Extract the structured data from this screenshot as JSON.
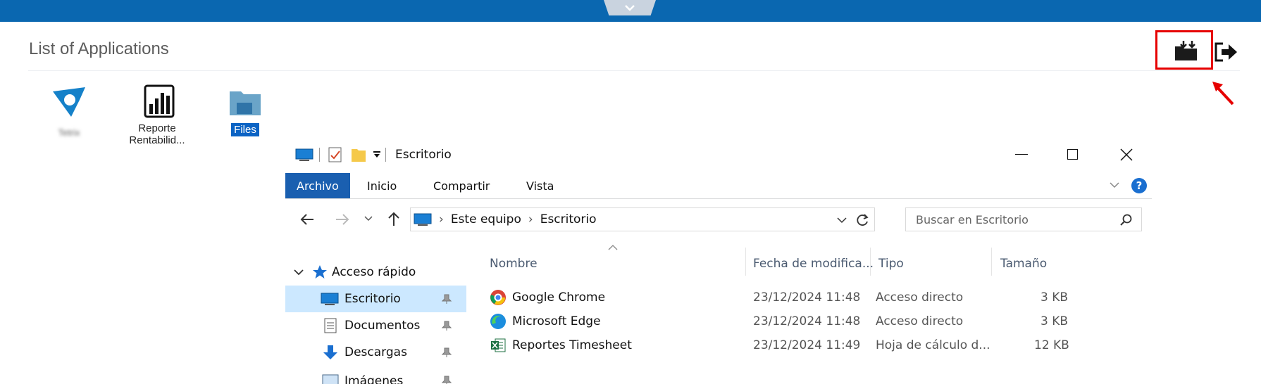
{
  "header": {
    "title": "List of Applications"
  },
  "apps": [
    {
      "label": "Tetrix"
    },
    {
      "label": "Reporte\nRentabilid..."
    },
    {
      "label": "Files"
    }
  ],
  "explorer": {
    "window_title": "Escritorio",
    "ribbon_tabs": [
      "Archivo",
      "Inicio",
      "Compartir",
      "Vista"
    ],
    "breadcrumb": [
      "Este equipo",
      "Escritorio"
    ],
    "search_placeholder": "Buscar en Escritorio",
    "nav": {
      "group": "Acceso rápido",
      "items": [
        "Escritorio",
        "Documentos",
        "Descargas",
        "Imágenes"
      ]
    },
    "columns": [
      "Nombre",
      "Fecha de modifica...",
      "Tipo",
      "Tamaño"
    ],
    "files": [
      {
        "name": "Google Chrome",
        "date": "23/12/2024 11:48",
        "type": "Acceso directo",
        "size": "3 KB"
      },
      {
        "name": "Microsoft Edge",
        "date": "23/12/2024 11:48",
        "type": "Acceso directo",
        "size": "3 KB"
      },
      {
        "name": "Reportes Timesheet",
        "date": "23/12/2024 11:49",
        "type": "Hoja de cálculo d...",
        "size": "12 KB"
      }
    ]
  },
  "colors": {
    "topbar": "#0a67b0",
    "highlight": "#e60000",
    "ribbon_active": "#1a5fb0",
    "nav_selected": "#cce8ff"
  }
}
